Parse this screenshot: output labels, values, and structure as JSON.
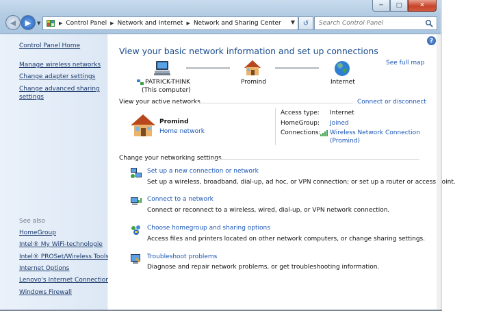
{
  "window": {
    "address": {
      "crumbs": [
        "Control Panel",
        "Network and Internet",
        "Network and Sharing Center"
      ]
    },
    "search_placeholder": "Search Control Panel"
  },
  "sidebar": {
    "home": "Control Panel Home",
    "tasks": [
      "Manage wireless networks",
      "Change adapter settings",
      "Change advanced sharing settings"
    ],
    "see_also_label": "See also",
    "see_also": [
      "HomeGroup",
      "Intel® My WiFi-technologie",
      "Intel® PROSet/Wireless Tools",
      "Internet Options",
      "Lenovo's Internet Connection",
      "Windows Firewall"
    ]
  },
  "main": {
    "title": "View your basic network information and set up connections",
    "see_full_map": "See full map",
    "map": {
      "computer_name": "PATRICK-THINK",
      "computer_sub": "(This computer)",
      "network_name": "Promind",
      "internet": "Internet"
    },
    "active": {
      "heading": "View your active networks",
      "connect_link": "Connect or disconnect",
      "network_name": "Promind",
      "network_type": "Home network",
      "access_type_label": "Access type:",
      "access_type_value": "Internet",
      "homegroup_label": "HomeGroup:",
      "homegroup_value": "Joined",
      "connections_label": "Connections:",
      "connections_value_1": "Wireless Network Connection",
      "connections_value_2": "(Promind)"
    },
    "settings": {
      "heading": "Change your networking settings",
      "items": [
        {
          "title": "Set up a new connection or network",
          "desc": "Set up a wireless, broadband, dial-up, ad hoc, or VPN connection; or set up a router or access point."
        },
        {
          "title": "Connect to a network",
          "desc": "Connect or reconnect to a wireless, wired, dial-up, or VPN network connection."
        },
        {
          "title": "Choose homegroup and sharing options",
          "desc": "Access files and printers located on other network computers, or change sharing settings."
        },
        {
          "title": "Troubleshoot problems",
          "desc": "Diagnose and repair network problems, or get troubleshooting information."
        }
      ]
    }
  }
}
